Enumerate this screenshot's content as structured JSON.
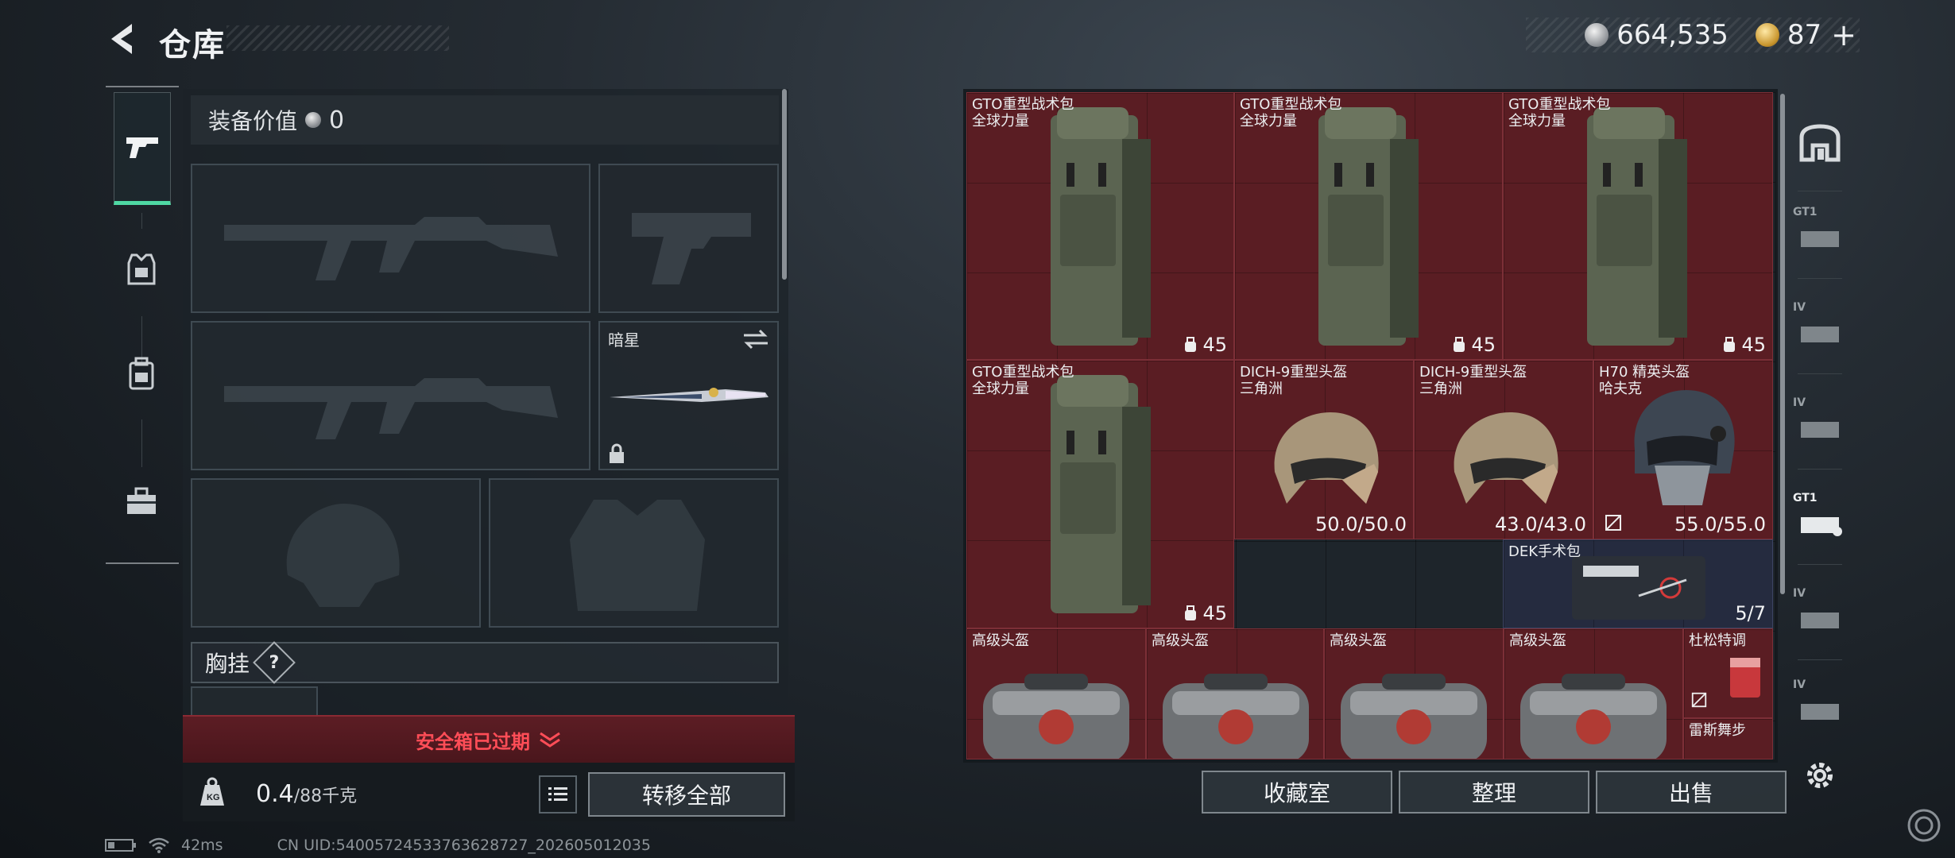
{
  "header": {
    "title": "仓库"
  },
  "currency": {
    "silver": "664,535",
    "gold": "87",
    "gold_plus": "+"
  },
  "loadout": {
    "equip_value_label": "装备价值",
    "equip_value": "0",
    "knife_slot_name": "暗星",
    "chest_rig_label": "胸挂",
    "help_symbol": "?"
  },
  "safe_box": {
    "status": "安全箱已过期"
  },
  "capacity": {
    "current": "0.4",
    "max_unit": "/88千克"
  },
  "buttons": {
    "transfer_all": "转移全部",
    "collection": "收藏室",
    "sort": "整理",
    "sell": "出售"
  },
  "stash_items": [
    {
      "name": "GTO重型战术包",
      "sub": "全球力量",
      "count": "45"
    },
    {
      "name": "GTO重型战术包",
      "sub": "全球力量",
      "count": "45"
    },
    {
      "name": "GTO重型战术包",
      "sub": "全球力量",
      "count": "45"
    },
    {
      "name": "GTO重型战术包",
      "sub": "全球力量",
      "count": "45"
    },
    {
      "name": "DICH-9重型头盔",
      "sub": "三角洲",
      "count": "50.0/50.0"
    },
    {
      "name": "DICH-9重型头盔",
      "sub": "三角洲",
      "count": "43.0/43.0"
    },
    {
      "name": "H70 精英头盔",
      "sub": "哈夫克",
      "count": "55.0/55.0"
    },
    {
      "name": "DEK手术包",
      "sub": "",
      "count": "5/7"
    },
    {
      "name": "高级头盔",
      "sub": "",
      "count": ""
    },
    {
      "name": "高级头盔",
      "sub": "",
      "count": ""
    },
    {
      "name": "高级头盔",
      "sub": "",
      "count": ""
    },
    {
      "name": "高级头盔",
      "sub": "",
      "count": ""
    },
    {
      "name": "杜松特调",
      "sub": "",
      "count": ""
    },
    {
      "name": "雷斯舞步",
      "sub": "",
      "count": ""
    }
  ],
  "right_rail": [
    "GT1",
    "IV",
    "IV",
    "GT1",
    "IV",
    "IV"
  ],
  "status_bar": {
    "ping": "42ms",
    "uid": "CN UID:54005724533763628727_202605012035"
  },
  "colors": {
    "accent_green": "#4fd8a3",
    "item_red": "#5a1d23",
    "item_navy": "#252b3f",
    "alert_red": "#ff4d57"
  }
}
